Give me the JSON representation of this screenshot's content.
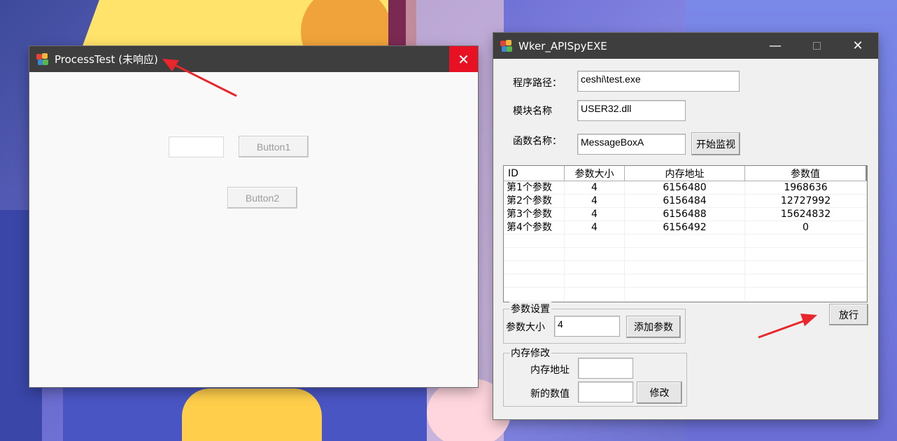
{
  "process_window": {
    "title": "ProcessTest (未响应)",
    "close_glyph": "✕",
    "input_value": "",
    "button1_label": "Button1",
    "button2_label": "Button2"
  },
  "spy_window": {
    "title": "Wker_APISpyEXE",
    "min_glyph": "—",
    "close_glyph": "✕",
    "path_label": "程序路径：",
    "path_value": "ceshi\\test.exe",
    "module_label": "模块名称",
    "module_value": "USER32.dll",
    "function_label": "函数名称：",
    "function_value": "MessageBoxA",
    "start_button": "开始监视",
    "table": {
      "columns": [
        "ID",
        "参数大小",
        "内存地址",
        "参数值"
      ],
      "rows": [
        [
          "第1个参数",
          "4",
          "6156480",
          "1968636"
        ],
        [
          "第2个参数",
          "4",
          "6156484",
          "12727992"
        ],
        [
          "第3个参数",
          "4",
          "6156488",
          "15624832"
        ],
        [
          "第4个参数",
          "4",
          "6156492",
          "0"
        ]
      ]
    },
    "param_group": {
      "title": "参数设置",
      "size_label": "参数大小",
      "size_value": "4",
      "add_button": "添加参数"
    },
    "release_button": "放行",
    "memory_group": {
      "title": "内存修改",
      "address_label": "内存地址",
      "address_value": "",
      "new_value_label": "新的数值",
      "new_value": "",
      "modify_button": "修改"
    }
  },
  "colors": {
    "titlebar": "#3f3e3e",
    "close_hover": "#e81123",
    "annotation_arrow": "#e8262b"
  }
}
